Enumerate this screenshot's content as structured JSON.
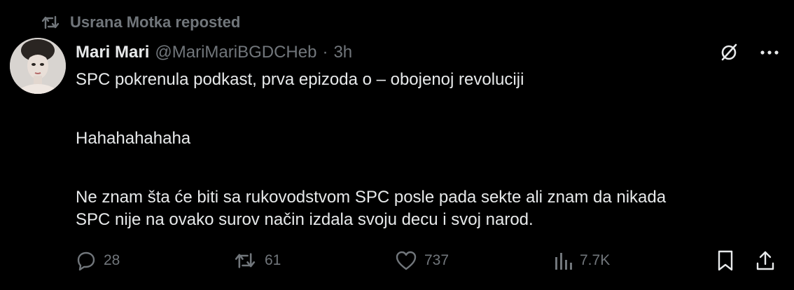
{
  "repost": {
    "text": "Usrana Motka reposted",
    "icon": "repost-icon"
  },
  "author": {
    "name": "Mari Mari",
    "handle": "@MariMariBGDCHeb",
    "separator": "·",
    "time": "3h"
  },
  "header_icons": [
    "grok-icon",
    "more-icon"
  ],
  "tweet": {
    "paragraphs": [
      "SPC pokrenula podkast, prva epizoda o – obojenoj revoluciji",
      "Hahahahahaha",
      "Ne znam šta će biti sa rukovodstvom SPC posle pada sekte ali znam da nikada",
      "SPC nije na ovako surov način izdala svoju decu i svoj narod."
    ]
  },
  "actions": {
    "replies": "28",
    "reposts": "61",
    "likes": "737",
    "views": "7.7K"
  },
  "colors": {
    "background": "#000000",
    "text": "#e7e9ea",
    "muted": "#71767b"
  }
}
